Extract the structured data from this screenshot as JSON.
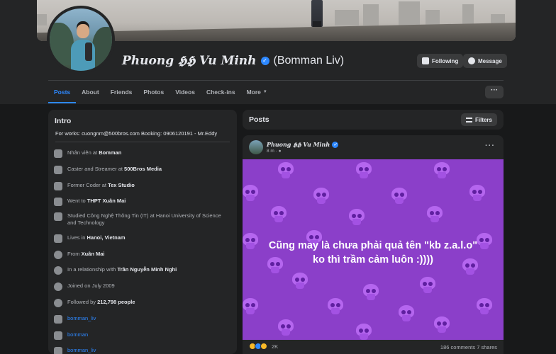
{
  "profile": {
    "name": "Phuong 𝕳𝕳 Vu Minh",
    "nickname": "(Bomman Liv)"
  },
  "actions": {
    "following_label": "Following",
    "message_label": "Message",
    "more_label": "···"
  },
  "tabs": [
    {
      "label": "Posts",
      "active": true
    },
    {
      "label": "About"
    },
    {
      "label": "Friends"
    },
    {
      "label": "Photos"
    },
    {
      "label": "Videos"
    },
    {
      "label": "Check-ins"
    },
    {
      "label": "More"
    }
  ],
  "intro": {
    "title": "Intro",
    "bio": "For works: cuongnm@500bros.com Booking: 0906120191 - Mr.Eddy",
    "items": [
      {
        "icon": "briefcase-icon",
        "prefix": "Nhân viên at ",
        "bold": "Bomman"
      },
      {
        "icon": "briefcase-icon",
        "prefix": "Caster and Streamer at ",
        "bold": "500Bros Media"
      },
      {
        "icon": "briefcase-icon",
        "prefix": "Former Coder at ",
        "bold": "Tex Studio"
      },
      {
        "icon": "graduation-cap-icon",
        "prefix": "Went to ",
        "bold": "THPT Xuân Mai"
      },
      {
        "icon": "graduation-cap-icon",
        "prefix": "Studied Công Nghệ Thông Tin (IT) at Hanoi University of Science and Technology",
        "bold": ""
      },
      {
        "icon": "home-icon",
        "prefix": "Lives in ",
        "bold": "Hanoi, Vietnam"
      },
      {
        "icon": "location-pin-icon",
        "prefix": "From ",
        "bold": "Xuân Mai"
      },
      {
        "icon": "heart-icon",
        "prefix": "In a relationship with ",
        "bold": "Trần Nguyễn Minh Nghi"
      },
      {
        "icon": "clock-icon",
        "prefix": "Joined on July 2009",
        "bold": ""
      },
      {
        "icon": "rss-icon",
        "prefix": "Followed by ",
        "bold": "212,798 people"
      },
      {
        "icon": "instagram-icon",
        "link": "bomman_liv"
      },
      {
        "icon": "youtube-icon",
        "link": "bomman"
      },
      {
        "icon": "twitter-icon",
        "link": "bomman_liv"
      }
    ]
  },
  "posts": {
    "title": "Posts",
    "filters_label": "Filters",
    "post": {
      "author": "Phuong 𝕳𝕳 Vu Minh",
      "time": "8 m ·",
      "more": "···",
      "caption_line1": "Cũng may là chưa phải quả tên \"kb z.a.l.o\"",
      "caption_line2": "ko thì trầm cảm luôn :))))",
      "reaction_count": "2K",
      "comments": "186 comments",
      "shares": "7 shares"
    }
  },
  "colors": {
    "accent": "#2d88ff",
    "background": "#18191a",
    "card": "#242526",
    "post_image": "#8b3fc9"
  }
}
